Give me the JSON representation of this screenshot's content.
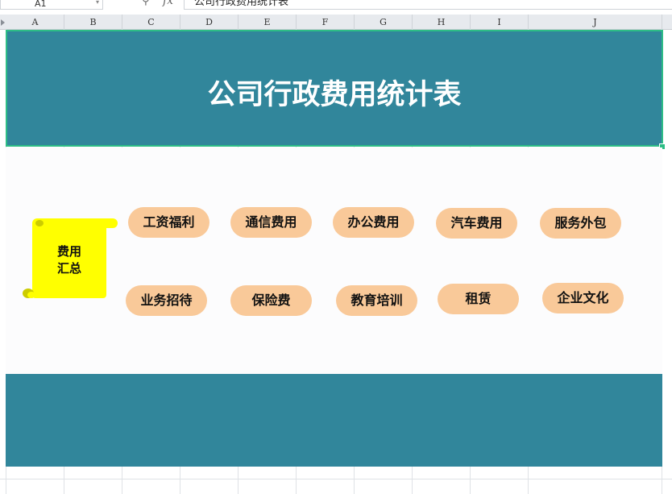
{
  "formula_bar": {
    "name_box": "A1",
    "fx": "fx",
    "content": "公司行政费用统计表"
  },
  "columns": [
    "A",
    "B",
    "C",
    "D",
    "E",
    "F",
    "G",
    "H",
    "I",
    "J"
  ],
  "sheet": {
    "title": "公司行政费用统计表",
    "summary_label_line1": "费用",
    "summary_label_line2": "汇总",
    "row1": [
      "工资福利",
      "通信费用",
      "办公费用",
      "汽车费用",
      "服务外包"
    ],
    "row2": [
      "业务招待",
      "保险费",
      "教育培训",
      "租赁",
      "企业文化"
    ]
  },
  "colors": {
    "title_band": "#31869b",
    "selection_border": "#2dbd86",
    "pill": "#f9c999",
    "scroll": "#ffff00"
  }
}
